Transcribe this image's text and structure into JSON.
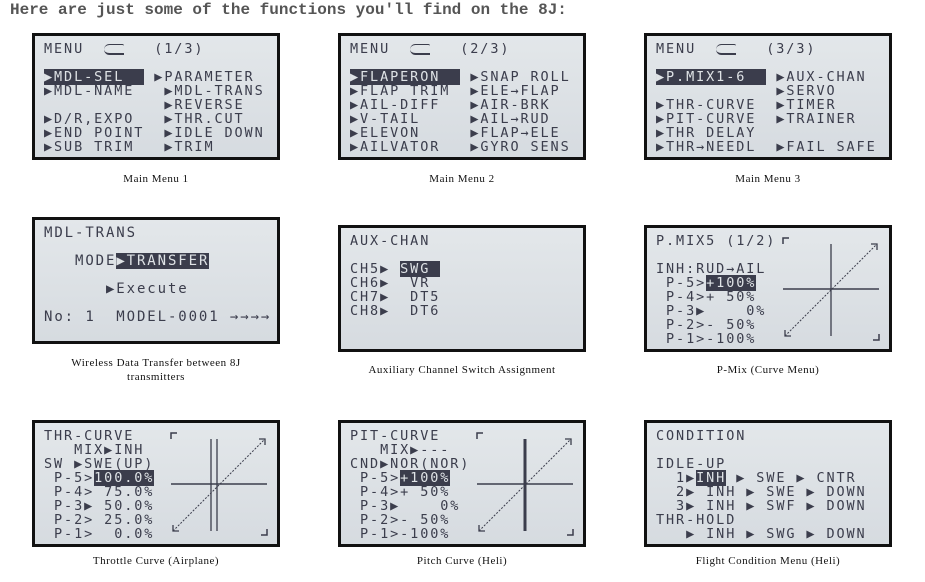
{
  "headline": "Here are just some of the functions you'll find on the 8J:",
  "screens": [
    {
      "caption": "Main Menu 1",
      "lines": [
        [
          "MENU  ",
          {
            "icon": "airplane-icon"
          },
          "   (1/3)"
        ],
        [
          ""
        ],
        [
          {
            "hl": "▶MDL-SEL  "
          },
          " ▶PARAMETER"
        ],
        [
          "▶MDL-NAME   ▶MDL-TRANS"
        ],
        [
          "            ▶REVERSE"
        ],
        [
          "▶D/R,EXPO   ▶THR.CUT"
        ],
        [
          "▶END POINT  ▶IDLE DOWN"
        ],
        [
          "▶SUB TRIM   ▶TRIM"
        ]
      ]
    },
    {
      "caption": "Main Menu 2",
      "lines": [
        [
          "MENU  ",
          {
            "icon": "airplane-icon"
          },
          "   (2/3)"
        ],
        [
          ""
        ],
        [
          {
            "hl": "▶FLAPERON  "
          },
          " ▶SNAP ROLL"
        ],
        [
          "▶FLAP TRIM  ▶ELE→FLAP"
        ],
        [
          "▶AIL-DIFF   ▶AIR-BRK"
        ],
        [
          "▶V-TAIL     ▶AIL→RUD"
        ],
        [
          "▶ELEVON     ▶FLAP→ELE"
        ],
        [
          "▶AILVATOR   ▶GYRO SENS"
        ]
      ]
    },
    {
      "caption": "Main Menu 3",
      "lines": [
        [
          "MENU  ",
          {
            "icon": "airplane-icon"
          },
          "   (3/3)"
        ],
        [
          ""
        ],
        [
          {
            "hl": "▶P.MIX1-6  "
          },
          " ▶AUX-CHAN"
        ],
        [
          "            ▶SERVO"
        ],
        [
          "▶THR-CURVE  ▶TIMER"
        ],
        [
          "▶PIT-CURVE  ▶TRAINER"
        ],
        [
          "▶THR DELAY"
        ],
        [
          "▶THR→NEEDL  ▶FAIL SAFE"
        ]
      ]
    },
    {
      "caption": "Wireless Data Transfer between 8J transmitters",
      "lines": [
        [
          "MDL-TRANS"
        ],
        [
          ""
        ],
        [
          "   MODE",
          {
            "hl": "▶TRANSFER"
          }
        ],
        [
          ""
        ],
        [
          "      ▶Execute"
        ],
        [
          ""
        ],
        [
          "No: 1  MODEL-0001 →→→→"
        ]
      ]
    },
    {
      "caption": "Auxiliary Channel Switch Assignment",
      "lines": [
        [
          "AUX-CHAN"
        ],
        [
          ""
        ],
        [
          "CH5▶ ",
          {
            "hl": "SWG "
          }
        ],
        [
          "CH6▶  VR"
        ],
        [
          "CH7▶  DT5"
        ],
        [
          "CH8▶  DT6"
        ]
      ]
    },
    {
      "caption": "P-Mix (Curve Menu)",
      "graph": "curve",
      "lines": [
        [
          "P.MIX5 (1/2)"
        ],
        [
          ""
        ],
        [
          "INH:RUD→AIL"
        ],
        [
          " P-5>",
          {
            "hl": "+100%"
          }
        ],
        [
          " P-4>+ 50%"
        ],
        [
          " P-3▶    0%"
        ],
        [
          " P-2>- 50%"
        ],
        [
          " P-1>-100%"
        ]
      ]
    },
    {
      "caption": "Throttle Curve (Airplane)",
      "graph": "throttle",
      "lines": [
        [
          "THR-CURVE"
        ],
        [
          "   MIX▶INH"
        ],
        [
          "SW ▶SWE(UP)"
        ],
        [
          " P-5>",
          {
            "hl": "100.0%"
          }
        ],
        [
          " P-4> 75.0%"
        ],
        [
          " P-3▶ 50.0%"
        ],
        [
          " P-2> 25.0%"
        ],
        [
          " P-1>  0.0%"
        ]
      ]
    },
    {
      "caption": "Pitch Curve (Heli)",
      "graph": "pitch",
      "lines": [
        [
          "PIT-CURVE"
        ],
        [
          "   MIX▶---"
        ],
        [
          "CND▶NOR(NOR)"
        ],
        [
          " P-5>",
          {
            "hl": "+100%"
          }
        ],
        [
          " P-4>+ 50%"
        ],
        [
          " P-3▶    0%"
        ],
        [
          " P-2>- 50%"
        ],
        [
          " P-1>-100%"
        ]
      ]
    },
    {
      "caption": "Flight Condition Menu (Heli)",
      "lines": [
        [
          "CONDITION"
        ],
        [
          ""
        ],
        [
          "IDLE-UP"
        ],
        [
          "  1▶",
          {
            "hl": "INH"
          },
          " ▶ SWE ▶ CNTR"
        ],
        [
          "  2▶ INH ▶ SWE ▶ DOWN"
        ],
        [
          "  3▶ INH ▶ SWF ▶ DOWN"
        ],
        [
          "THR-HOLD"
        ],
        [
          "   ▶ INH ▶ SWG ▶ DOWN"
        ]
      ]
    }
  ],
  "colors": {
    "lcd_text": "#3b3d4c",
    "lcd_bg": "#dde1e5",
    "bezel": "#111111"
  }
}
